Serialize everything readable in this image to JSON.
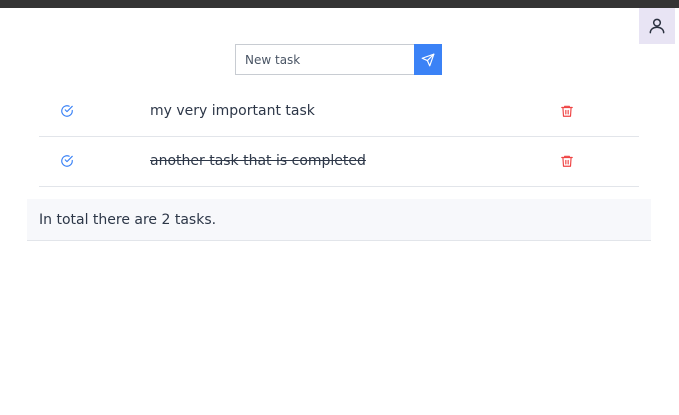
{
  "header": {
    "profile_icon": "user-icon"
  },
  "new_task": {
    "placeholder": "New task",
    "value": "",
    "submit_icon": "send-icon"
  },
  "tasks": [
    {
      "text": "my very important task",
      "completed": false,
      "check_icon": "check-circle-icon",
      "delete_icon": "trash-icon"
    },
    {
      "text": "another task that is completed",
      "completed": true,
      "check_icon": "check-circle-icon",
      "delete_icon": "trash-icon"
    }
  ],
  "summary": {
    "text": "In total there are 2 tasks."
  },
  "colors": {
    "accent": "#3b82f6",
    "danger": "#ef4444",
    "topbar": "#343434",
    "profile_bg": "#e8e4f4"
  }
}
